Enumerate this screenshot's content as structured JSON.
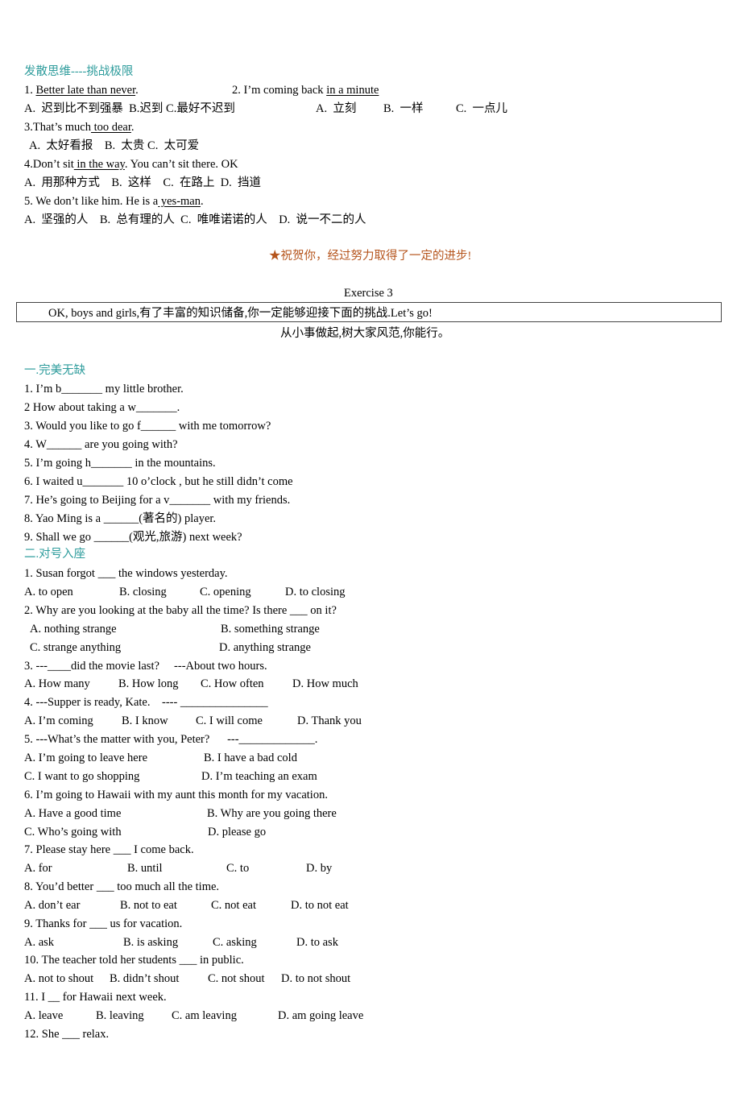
{
  "section_challenge": {
    "heading": "发散思维----挑战极限",
    "q1": {
      "num": "1. ",
      "phrase": "Better late than never",
      "tail": "."
    },
    "q2": {
      "num": "2. I’m coming back ",
      "phrase": "in a minute"
    },
    "q1_options": "A.  迟到比不到强暴  B.迟到 C.最好不迟到",
    "q2_options": [
      "A.  立刻",
      "B.  一样",
      "C.  一点儿"
    ],
    "q3": {
      "num": "3.That’s much",
      "phrase": " too dear",
      "tail": "."
    },
    "q3_options": "A.  太好看报    B.  太贵 C.  太可爱",
    "q4": {
      "num": "4.Don’t sit",
      "phrase": " in the way",
      "tail": ". You can’t sit there. OK"
    },
    "q4_options": "A.  用那种方式    B.  这样    C.  在路上  D.  挡道",
    "q5": {
      "num": "5. We don’t like him. He is a",
      "phrase": " yes-man",
      "tail": "."
    },
    "q5_options": "A.  坚强的人    B.  总有理的人  C.  唯唯诺诺的人    D.  说一不二的人"
  },
  "congrats": "★祝贺你，经过努力取得了一定的进步!",
  "exercise": {
    "title": "Exercise 3",
    "intro": "OK, boys and girls,有了丰富的知识储备,你一定能够迎接下面的挑战.Let’s go!",
    "motto": "从小事做起,树大家风范,你能行。"
  },
  "part1": {
    "heading": "一.完美无缺",
    "items": [
      "1. I’m b_______ my little brother.",
      "2 How about taking a w_______.",
      "3. Would you like to go f______ with me tomorrow?",
      "4. W______ are you going with?",
      "5. I’m going h_______ in the mountains.",
      "6. I waited u_______ 10 o’clock , but he still didn’t come",
      "7. He’s going to Beijing for a v_______ with my friends.",
      "8. Yao Ming is a ______(著名的) player.",
      "9. Shall we go ______(观光,旅游) next week?"
    ]
  },
  "part2": {
    "heading": "二.对号入座",
    "questions": [
      {
        "q": "1. Susan forgot ___ the windows yesterday.",
        "options": [
          "A. to open",
          "B. closing",
          "C. opening",
          "D. to closing"
        ]
      },
      {
        "q": "2. Why are you looking at the baby all the time? Is there ___ on it?",
        "options": [
          "A. nothing strange",
          "B. something strange",
          "C. strange anything",
          "D. anything strange"
        ]
      },
      {
        "q": "3. ---____did the movie last?     ---About two hours.",
        "options": [
          "A. How many",
          "B. How long",
          "C. How often",
          "D. How much"
        ]
      },
      {
        "q": "4. ---Supper is ready, Kate.    ---- _______________",
        "options": [
          "A. I’m coming",
          "B. I know",
          "C. I will come",
          "D. Thank you"
        ]
      },
      {
        "q": "5. ---What’s the matter with you, Peter?      ---_____________.",
        "options": [
          "A. I’m going to leave here",
          "B. I have a bad cold",
          "C. I want to go shopping",
          "D. I’m teaching an exam"
        ]
      },
      {
        "q": "6. I’m going to Hawaii with my aunt this month for my vacation.",
        "options": [
          "A. Have a good time",
          "B. Why are you going there",
          "C. Who’s going with",
          "D. please go"
        ]
      },
      {
        "q": "7. Please stay here ___ I come back.",
        "options": [
          "A. for",
          "B. until",
          "C. to",
          "D. by"
        ]
      },
      {
        "q": "8. You’d better ___ too much all the time.",
        "options": [
          "A. don’t ear",
          "B. not to eat",
          "C. not eat",
          "D. to not eat"
        ]
      },
      {
        "q": "9. Thanks for ___ us for vacation.",
        "options": [
          "A. ask",
          "B. is asking",
          "C. asking",
          "D. to ask"
        ]
      },
      {
        "q": "10. The teacher told her students ___ in public.",
        "options": [
          "A. not to shout",
          "B. didn’t shout",
          "C. not shout",
          "D. to not shout"
        ]
      },
      {
        "q": "11. I __ for Hawaii next week.",
        "options": [
          "A. leave",
          "B. leaving",
          "C. am leaving",
          "D. am going leave"
        ]
      },
      {
        "q": "12. She ___ relax.",
        "options": []
      }
    ]
  }
}
